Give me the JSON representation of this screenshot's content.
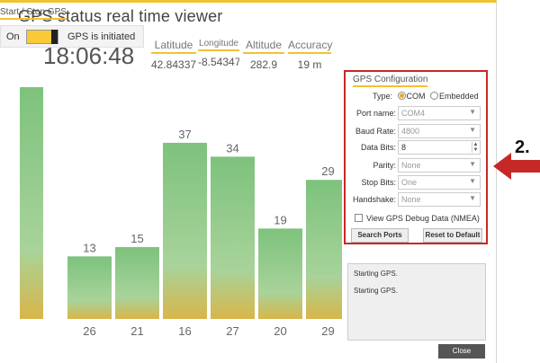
{
  "window": {
    "title": "GPS status real time viewer"
  },
  "readouts": {
    "clock": "18:06:48",
    "latitude": {
      "label": "Latitude",
      "value": "42.843372"
    },
    "longitude": {
      "label": "Longitude",
      "value": "-8.543478"
    },
    "altitude": {
      "label": "Altitude",
      "value": "282.9"
    },
    "accuracy": {
      "label": "Accuracy",
      "value": "19 m"
    }
  },
  "chart_data": {
    "type": "bar",
    "categories": [
      "26",
      "",
      "21",
      "16",
      "27",
      "20",
      "29"
    ],
    "bars": [
      {
        "top_value": "",
        "bottom_label": "",
        "value": 100
      },
      {
        "top_value": "13",
        "bottom_label": "26",
        "value": 27
      },
      {
        "top_value": "15",
        "bottom_label": "21",
        "value": 31
      },
      {
        "top_value": "37",
        "bottom_label": "16",
        "value": 76
      },
      {
        "top_value": "34",
        "bottom_label": "27",
        "value": 70
      },
      {
        "top_value": "19",
        "bottom_label": "20",
        "value": 39
      },
      {
        "top_value": "29",
        "bottom_label": "29",
        "value": 60
      }
    ],
    "colors": {
      "top": "#7dc27d",
      "bottom": "#d8b64a"
    }
  },
  "startstop": {
    "title": "Start / Stop GPS",
    "on_label": "On",
    "status": "GPS is initiated"
  },
  "config": {
    "title": "GPS Configuration",
    "type_label": "Type:",
    "type_options": [
      "COM",
      "Embedded"
    ],
    "port_name_label": "Port name:",
    "port_name_value": "COM4",
    "baud_rate_label": "Baud Rate:",
    "baud_rate_value": "4800",
    "data_bits_label": "Data Bits:",
    "data_bits_value": "8",
    "parity_label": "Parity:",
    "parity_value": "None",
    "stop_bits_label": "Stop Bits:",
    "stop_bits_value": "One",
    "handshake_label": "Handshake:",
    "handshake_value": "None",
    "debug_label": "View GPS Debug Data (NMEA)",
    "search_button": "Search Ports",
    "reset_button": "Reset to Default"
  },
  "log": [
    "Starting GPS.",
    "Starting GPS."
  ],
  "close_button": "Close",
  "annotation": {
    "number": "2.",
    "color": "#c62828"
  }
}
